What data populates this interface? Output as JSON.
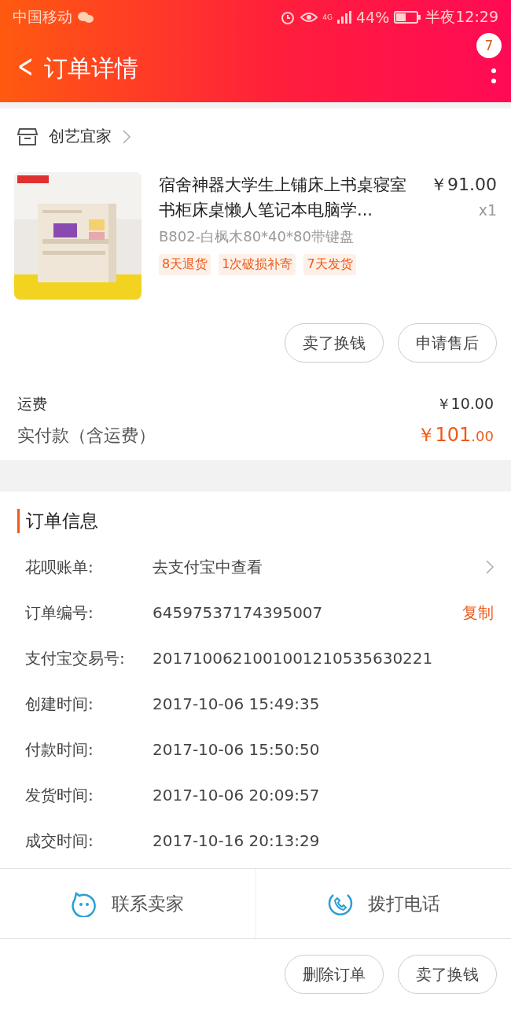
{
  "status_bar": {
    "carrier": "中国移动",
    "network": "4G",
    "battery": "44%",
    "time": "半夜12:29"
  },
  "header": {
    "back": "<",
    "title": "订单详情",
    "badge": "7"
  },
  "store": {
    "name": "创艺宜家"
  },
  "product": {
    "title": "宿舍神器大学生上铺床上书桌寝室书柜床桌懒人笔记本电脑学...",
    "price": "￥91.00",
    "quantity": "x1",
    "sku": "B802-白枫木80*40*80带键盘",
    "tags": [
      "8天退货",
      "1次破损补寄",
      "7天发货"
    ]
  },
  "item_buttons": [
    "卖了换钱",
    "申请售后"
  ],
  "fees": [
    {
      "label": "运费",
      "value": "￥10.00",
      "kind": "plain"
    },
    {
      "label": "实付款（含运费）",
      "value": "￥101",
      "decimals": ".00",
      "kind": "total"
    }
  ],
  "order_info": {
    "title": "订单信息",
    "rows": [
      {
        "label": "花呗账单:",
        "value": "去支付宝中查看",
        "kind": "link"
      },
      {
        "label": "订单编号:",
        "value": "64597537174395007",
        "action": "复制",
        "kind": "copy"
      },
      {
        "label": "支付宝交易号:",
        "value": "2017100621001001210535630221",
        "kind": "plain"
      },
      {
        "label": "创建时间:",
        "value": "2017-10-06 15:49:35",
        "kind": "plain"
      },
      {
        "label": "付款时间:",
        "value": "2017-10-06 15:50:50",
        "kind": "plain"
      },
      {
        "label": "发货时间:",
        "value": "2017-10-06 20:09:57",
        "kind": "plain"
      },
      {
        "label": "成交时间:",
        "value": "2017-10-16 20:13:29",
        "kind": "plain"
      }
    ]
  },
  "contact": [
    {
      "label": "联系卖家",
      "kind": "chat"
    },
    {
      "label": "拨打电话",
      "kind": "phone"
    }
  ],
  "bottom_buttons": [
    "删除订单",
    "卖了换钱"
  ]
}
